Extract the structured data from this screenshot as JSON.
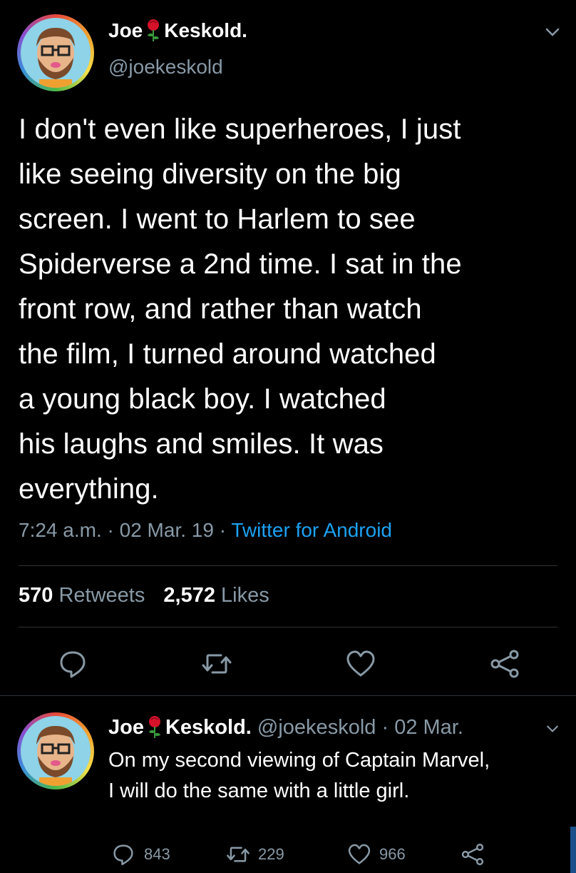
{
  "main_tweet": {
    "author_name_first": "Joe",
    "author_name_last": "Keskold.",
    "handle": "@joekeskold",
    "lines": [
      "I don't even like superheroes, I just",
      "like seeing diversity on the big",
      "screen. I went to Harlem to see",
      "Spiderverse a 2nd time. I sat in the",
      "front row, and rather than watch",
      "the film, I turned around watched",
      "a young black boy. I watched",
      "his laughs and smiles. It was",
      "everything."
    ],
    "time": "7:24 a.m.",
    "date": "02 Mar. 19",
    "source": "Twitter for Android",
    "sep": "·",
    "retweets_count": "570",
    "retweets_label": "Retweets",
    "likes_count": "2,572",
    "likes_label": "Likes"
  },
  "reply_tweet": {
    "author_name_first": "Joe",
    "author_name_last": "Keskold.",
    "handle": "@joekeskold",
    "sep": "·",
    "date": "02 Mar.",
    "lines": [
      "On my second viewing of Captain Marvel,",
      "I will do the same with a little girl."
    ],
    "reply_count": "843",
    "retweet_count": "229",
    "like_count": "966"
  },
  "icons": {
    "reply": "reply-icon",
    "retweet": "retweet-icon",
    "like": "heart-icon",
    "share": "share-icon",
    "menu": "chevron-down-icon",
    "rose": "rose-emoji"
  },
  "colors": {
    "background": "#000000",
    "secondary_text": "#8899a6",
    "link": "#1da1f2",
    "divider": "#2f3336"
  }
}
